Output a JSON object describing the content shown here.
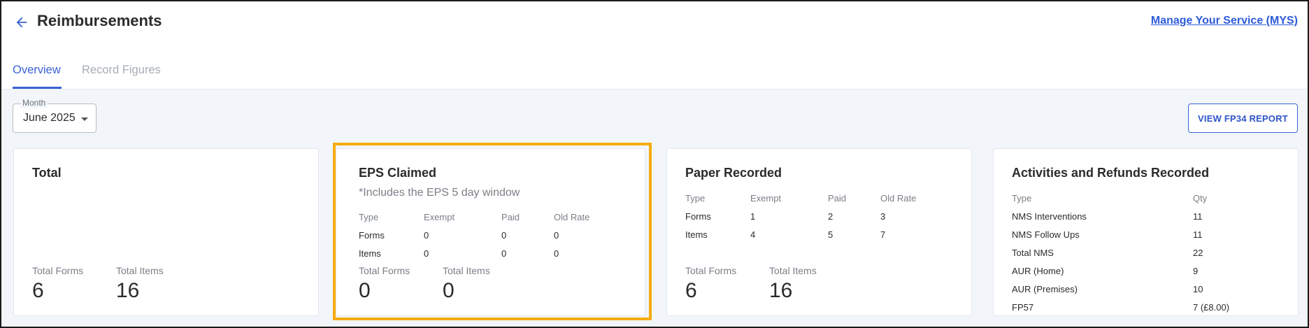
{
  "header": {
    "title": "Reimbursements",
    "mys_link": "Manage Your Service (MYS)"
  },
  "tabs": [
    {
      "label": "Overview",
      "active": true
    },
    {
      "label": "Record Figures",
      "active": false
    }
  ],
  "filters": {
    "month_label": "Month",
    "month_value": "June 2025"
  },
  "actions": {
    "fp34_report": "VIEW FP34 REPORT"
  },
  "cards": {
    "total": {
      "title": "Total",
      "total_forms_label": "Total Forms",
      "total_forms": "6",
      "total_items_label": "Total Items",
      "total_items": "16"
    },
    "eps": {
      "title": "EPS Claimed",
      "subtitle": "*Includes the EPS 5 day window",
      "columns": [
        "Type",
        "Exempt",
        "Paid",
        "Old Rate"
      ],
      "rows": [
        [
          "Forms",
          "0",
          "0",
          "0"
        ],
        [
          "Items",
          "0",
          "0",
          "0"
        ]
      ],
      "total_forms_label": "Total Forms",
      "total_forms": "0",
      "total_items_label": "Total Items",
      "total_items": "0"
    },
    "paper": {
      "title": "Paper Recorded",
      "columns": [
        "Type",
        "Exempt",
        "Paid",
        "Old Rate"
      ],
      "rows": [
        [
          "Forms",
          "1",
          "2",
          "3"
        ],
        [
          "Items",
          "4",
          "5",
          "7"
        ]
      ],
      "total_forms_label": "Total Forms",
      "total_forms": "6",
      "total_items_label": "Total Items",
      "total_items": "16"
    },
    "activities": {
      "title": "Activities and Refunds Recorded",
      "columns": [
        "Type",
        "Qty"
      ],
      "rows": [
        [
          "NMS Interventions",
          "11"
        ],
        [
          "NMS Follow Ups",
          "11"
        ],
        [
          "Total NMS",
          "22"
        ],
        [
          "AUR (Home)",
          "9"
        ],
        [
          "AUR (Premises)",
          "10"
        ],
        [
          "FP57",
          "7 (£8.00)"
        ]
      ]
    }
  },
  "colors": {
    "accent": "#3b63d3",
    "highlight": "#f6ac0f",
    "background": "#f2f6fb"
  }
}
